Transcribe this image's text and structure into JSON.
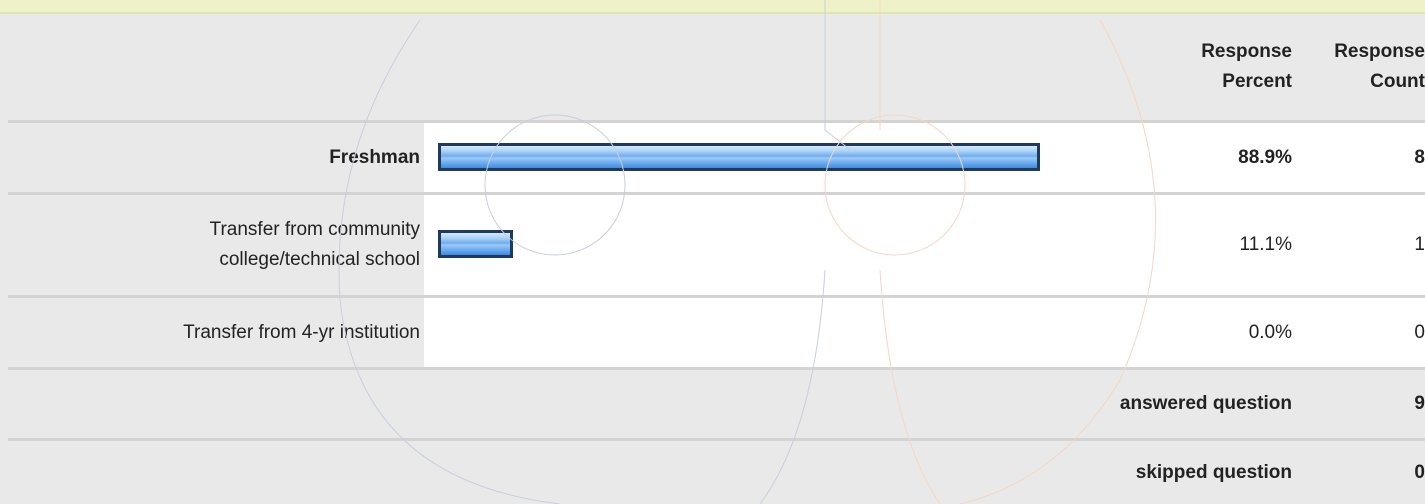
{
  "chart_data": {
    "type": "bar",
    "orientation": "horizontal",
    "columns": {
      "percent_header": [
        "Response",
        "Percent"
      ],
      "count_header": [
        "Response",
        "Count"
      ]
    },
    "categories": [
      "Freshman",
      "Transfer from community college/technical school",
      "Transfer from 4-yr institution"
    ],
    "category_lines": [
      [
        "Freshman"
      ],
      [
        "Transfer from community",
        "college/technical school"
      ],
      [
        "Transfer from 4-yr institution"
      ]
    ],
    "percent_values": [
      88.9,
      11.1,
      0.0
    ],
    "percent_labels": [
      "88.9%",
      "11.1%",
      "0.0%"
    ],
    "count_values": [
      8,
      1,
      0
    ],
    "count_labels": [
      "8",
      "1",
      "0"
    ],
    "highlight_index": 0,
    "xlim": [
      0,
      100
    ],
    "answered_question": {
      "label": "answered question",
      "value": "9"
    },
    "skipped_question": {
      "label": "skipped question",
      "value": "0"
    },
    "bar_border_color": "#1e3a5c",
    "bar_fill_color": "#6eaef0"
  }
}
